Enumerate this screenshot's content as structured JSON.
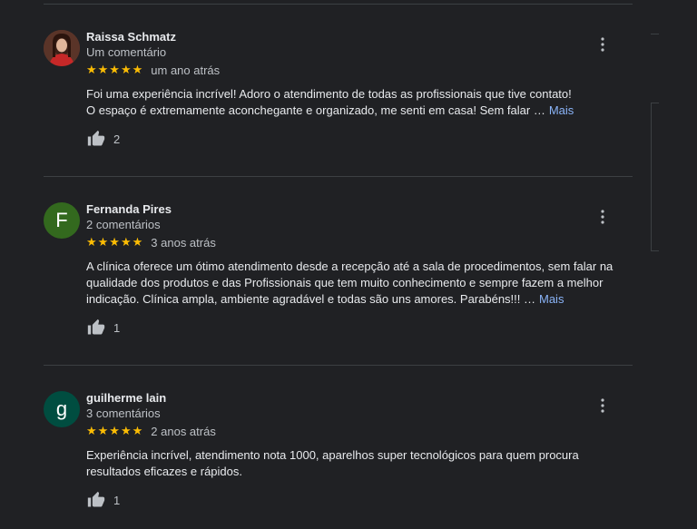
{
  "reviews": [
    {
      "name": "Raissa Schmatz",
      "count": "Um comentário",
      "stars": "★★★★★",
      "time": "um ano atrás",
      "text_lines": [
        "Foi uma experiência incrível! Adoro o atendimento de todas as profissionais que tive contato!",
        "O espaço é extremamente aconchegante e organizado, me senti em casa! Sem falar …"
      ],
      "more": "Mais",
      "likes": "2",
      "avatar": "photo"
    },
    {
      "name": "Fernanda Pires",
      "count": "2 comentários",
      "stars": "★★★★★",
      "time": "3 anos atrás",
      "text_lines": [
        "A clínica oferece um ótimo atendimento desde a recepção até a sala de procedimentos, sem falar na",
        "qualidade dos produtos e das Profissionais que tem muito conhecimento e sempre fazem a melhor",
        "indicação. Clínica ampla, ambiente agradável e todas são uns amores. Parabéns!!! …"
      ],
      "more": "Mais",
      "likes": "1",
      "avatar_letter": "F",
      "avatar_color": "#33691e"
    },
    {
      "name": "guilherme lain",
      "count": "3 comentários",
      "stars": "★★★★★",
      "time": "2 anos atrás",
      "text_lines": [
        "Experiência incrível, atendimento nota 1000, aparelhos super tecnológicos para quem procura",
        "resultados eficazes e rápidos."
      ],
      "likes": "1",
      "avatar_letter": "g",
      "avatar_color": "#004d40"
    }
  ],
  "colors": {
    "background": "#202124",
    "star": "#fbbc04",
    "link": "#8ab4f8",
    "divider": "#3c4043"
  },
  "icons": [
    "thumbs-up-icon",
    "more-vert-icon"
  ]
}
